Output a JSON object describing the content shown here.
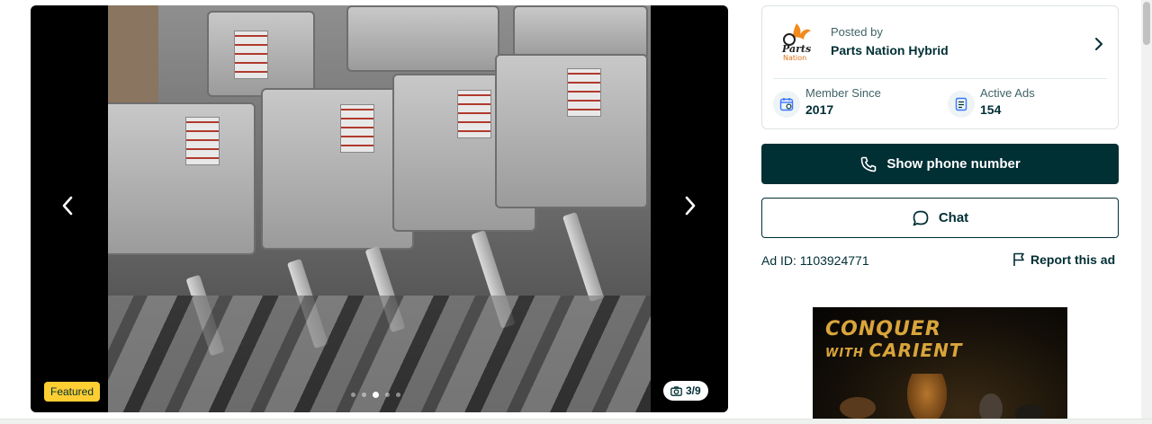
{
  "gallery": {
    "badge": "Featured",
    "counter": "3/9",
    "prev_icon": "chevron-left-icon",
    "next_icon": "chevron-right-icon",
    "dots": [
      false,
      false,
      true,
      false,
      false
    ]
  },
  "seller": {
    "logo_line1": "Parts",
    "logo_line2": "Nation",
    "posted_by_label": "Posted by",
    "name": "Parts Nation Hybrid",
    "member_since_label": "Member Since",
    "member_since_value": "2017",
    "active_ads_label": "Active Ads",
    "active_ads_value": "154"
  },
  "actions": {
    "phone_label": "Show phone number",
    "chat_label": "Chat",
    "ad_id": "Ad ID: 1103924771",
    "report_label": "Report this ad"
  },
  "ad_banner": {
    "line1": "CONQUER",
    "line2_small": "WITH ",
    "line2_big": "CARIENT"
  },
  "colors": {
    "primary": "#002f34",
    "featured_badge": "#ffce32",
    "banner_gold": "#d9a53b"
  }
}
